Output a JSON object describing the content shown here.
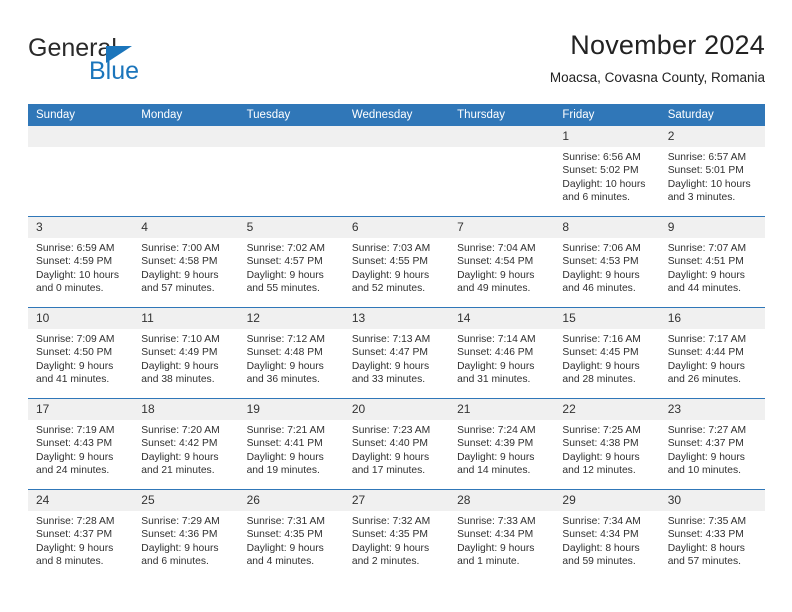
{
  "brand": {
    "name_top": "General",
    "name_bottom": "Blue",
    "accent_color": "#1b75bb"
  },
  "header": {
    "title": "November 2024",
    "subtitle": "Moacsa, Covasna County, Romania"
  },
  "theme": {
    "header_blue": "#3077b8",
    "daynum_band": "#f0f0f0",
    "text": "#303030"
  },
  "calendar": {
    "weekday_headers": [
      "Sunday",
      "Monday",
      "Tuesday",
      "Wednesday",
      "Thursday",
      "Friday",
      "Saturday"
    ],
    "weeks": [
      [
        {
          "day": "",
          "empty": true
        },
        {
          "day": "",
          "empty": true
        },
        {
          "day": "",
          "empty": true
        },
        {
          "day": "",
          "empty": true
        },
        {
          "day": "",
          "empty": true
        },
        {
          "day": "1",
          "sunrise": "Sunrise: 6:56 AM",
          "sunset": "Sunset: 5:02 PM",
          "daylight": "Daylight: 10 hours and 6 minutes."
        },
        {
          "day": "2",
          "sunrise": "Sunrise: 6:57 AM",
          "sunset": "Sunset: 5:01 PM",
          "daylight": "Daylight: 10 hours and 3 minutes."
        }
      ],
      [
        {
          "day": "3",
          "sunrise": "Sunrise: 6:59 AM",
          "sunset": "Sunset: 4:59 PM",
          "daylight": "Daylight: 10 hours and 0 minutes."
        },
        {
          "day": "4",
          "sunrise": "Sunrise: 7:00 AM",
          "sunset": "Sunset: 4:58 PM",
          "daylight": "Daylight: 9 hours and 57 minutes."
        },
        {
          "day": "5",
          "sunrise": "Sunrise: 7:02 AM",
          "sunset": "Sunset: 4:57 PM",
          "daylight": "Daylight: 9 hours and 55 minutes."
        },
        {
          "day": "6",
          "sunrise": "Sunrise: 7:03 AM",
          "sunset": "Sunset: 4:55 PM",
          "daylight": "Daylight: 9 hours and 52 minutes."
        },
        {
          "day": "7",
          "sunrise": "Sunrise: 7:04 AM",
          "sunset": "Sunset: 4:54 PM",
          "daylight": "Daylight: 9 hours and 49 minutes."
        },
        {
          "day": "8",
          "sunrise": "Sunrise: 7:06 AM",
          "sunset": "Sunset: 4:53 PM",
          "daylight": "Daylight: 9 hours and 46 minutes."
        },
        {
          "day": "9",
          "sunrise": "Sunrise: 7:07 AM",
          "sunset": "Sunset: 4:51 PM",
          "daylight": "Daylight: 9 hours and 44 minutes."
        }
      ],
      [
        {
          "day": "10",
          "sunrise": "Sunrise: 7:09 AM",
          "sunset": "Sunset: 4:50 PM",
          "daylight": "Daylight: 9 hours and 41 minutes."
        },
        {
          "day": "11",
          "sunrise": "Sunrise: 7:10 AM",
          "sunset": "Sunset: 4:49 PM",
          "daylight": "Daylight: 9 hours and 38 minutes."
        },
        {
          "day": "12",
          "sunrise": "Sunrise: 7:12 AM",
          "sunset": "Sunset: 4:48 PM",
          "daylight": "Daylight: 9 hours and 36 minutes."
        },
        {
          "day": "13",
          "sunrise": "Sunrise: 7:13 AM",
          "sunset": "Sunset: 4:47 PM",
          "daylight": "Daylight: 9 hours and 33 minutes."
        },
        {
          "day": "14",
          "sunrise": "Sunrise: 7:14 AM",
          "sunset": "Sunset: 4:46 PM",
          "daylight": "Daylight: 9 hours and 31 minutes."
        },
        {
          "day": "15",
          "sunrise": "Sunrise: 7:16 AM",
          "sunset": "Sunset: 4:45 PM",
          "daylight": "Daylight: 9 hours and 28 minutes."
        },
        {
          "day": "16",
          "sunrise": "Sunrise: 7:17 AM",
          "sunset": "Sunset: 4:44 PM",
          "daylight": "Daylight: 9 hours and 26 minutes."
        }
      ],
      [
        {
          "day": "17",
          "sunrise": "Sunrise: 7:19 AM",
          "sunset": "Sunset: 4:43 PM",
          "daylight": "Daylight: 9 hours and 24 minutes."
        },
        {
          "day": "18",
          "sunrise": "Sunrise: 7:20 AM",
          "sunset": "Sunset: 4:42 PM",
          "daylight": "Daylight: 9 hours and 21 minutes."
        },
        {
          "day": "19",
          "sunrise": "Sunrise: 7:21 AM",
          "sunset": "Sunset: 4:41 PM",
          "daylight": "Daylight: 9 hours and 19 minutes."
        },
        {
          "day": "20",
          "sunrise": "Sunrise: 7:23 AM",
          "sunset": "Sunset: 4:40 PM",
          "daylight": "Daylight: 9 hours and 17 minutes."
        },
        {
          "day": "21",
          "sunrise": "Sunrise: 7:24 AM",
          "sunset": "Sunset: 4:39 PM",
          "daylight": "Daylight: 9 hours and 14 minutes."
        },
        {
          "day": "22",
          "sunrise": "Sunrise: 7:25 AM",
          "sunset": "Sunset: 4:38 PM",
          "daylight": "Daylight: 9 hours and 12 minutes."
        },
        {
          "day": "23",
          "sunrise": "Sunrise: 7:27 AM",
          "sunset": "Sunset: 4:37 PM",
          "daylight": "Daylight: 9 hours and 10 minutes."
        }
      ],
      [
        {
          "day": "24",
          "sunrise": "Sunrise: 7:28 AM",
          "sunset": "Sunset: 4:37 PM",
          "daylight": "Daylight: 9 hours and 8 minutes."
        },
        {
          "day": "25",
          "sunrise": "Sunrise: 7:29 AM",
          "sunset": "Sunset: 4:36 PM",
          "daylight": "Daylight: 9 hours and 6 minutes."
        },
        {
          "day": "26",
          "sunrise": "Sunrise: 7:31 AM",
          "sunset": "Sunset: 4:35 PM",
          "daylight": "Daylight: 9 hours and 4 minutes."
        },
        {
          "day": "27",
          "sunrise": "Sunrise: 7:32 AM",
          "sunset": "Sunset: 4:35 PM",
          "daylight": "Daylight: 9 hours and 2 minutes."
        },
        {
          "day": "28",
          "sunrise": "Sunrise: 7:33 AM",
          "sunset": "Sunset: 4:34 PM",
          "daylight": "Daylight: 9 hours and 1 minute."
        },
        {
          "day": "29",
          "sunrise": "Sunrise: 7:34 AM",
          "sunset": "Sunset: 4:34 PM",
          "daylight": "Daylight: 8 hours and 59 minutes."
        },
        {
          "day": "30",
          "sunrise": "Sunrise: 7:35 AM",
          "sunset": "Sunset: 4:33 PM",
          "daylight": "Daylight: 8 hours and 57 minutes."
        }
      ]
    ]
  }
}
